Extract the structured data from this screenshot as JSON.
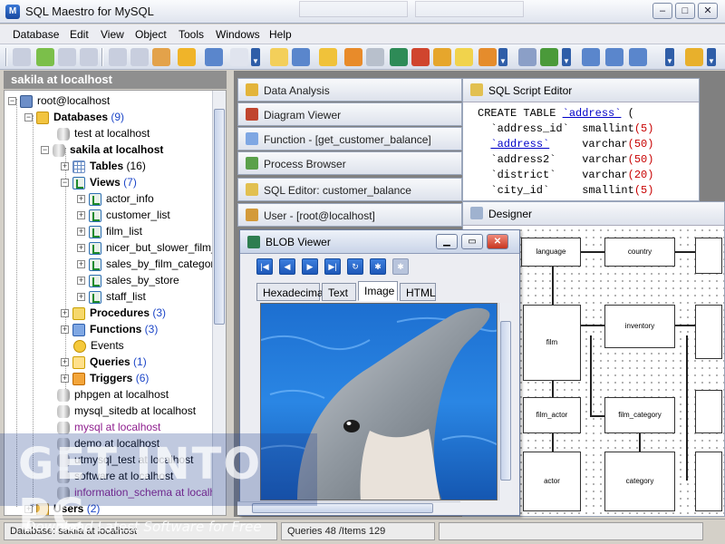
{
  "app": {
    "title": "SQL Maestro for MySQL"
  },
  "window_controls": {
    "minimize": "–",
    "maximize": "□",
    "close": "✕"
  },
  "menu": {
    "items": [
      "Database",
      "Edit",
      "View",
      "Object",
      "Tools",
      "Windows",
      "Help"
    ]
  },
  "explorer": {
    "header": "sakila at localhost",
    "tree": {
      "root": "root@localhost",
      "databases_label": "Databases",
      "databases_count": "(9)",
      "test": "test at localhost",
      "sakila": "sakila at localhost",
      "tables_label": "Tables",
      "tables_count": "(16)",
      "views_label": "Views",
      "views_count": "(7)",
      "views": [
        "actor_info",
        "customer_list",
        "film_list",
        "nicer_but_slower_film_",
        "sales_by_film_categor",
        "sales_by_store",
        "staff_list"
      ],
      "procedures_label": "Procedures",
      "procedures_count": "(3)",
      "functions_label": "Functions",
      "functions_count": "(3)",
      "events_label": "Events",
      "queries_label": "Queries",
      "queries_count": "(1)",
      "triggers_label": "Triggers",
      "triggers_count": "(6)",
      "other_dbs": [
        "phpgen at localhost",
        "mysql_sitedb at localhost",
        "mysql at localhost",
        "demo at localhost",
        "utmysql_test at localhost",
        "software at localhost",
        "information_schema at localhos"
      ],
      "users_label": "Users",
      "users_count": "(2)"
    }
  },
  "mdi_windows": [
    "Data Analysis",
    "Diagram Viewer",
    "Function - [get_customer_balance]",
    "Process Browser",
    "SQL Editor: customer_balance",
    "User - [root@localhost]"
  ],
  "sql_editor": {
    "title": "SQL Script Editor",
    "lines": [
      {
        "a": "CREATE TABLE ",
        "b": "`address`",
        "c": " ("
      },
      {
        "a": "  `address_id`  ",
        "b": "smallint",
        "c": "(5)"
      },
      {
        "a": "  ",
        "b2": "`address`",
        "c2": "     varchar",
        "d": "(50)"
      },
      {
        "a": "  `address2`    ",
        "b": "varchar",
        "c": "(50)"
      },
      {
        "a": "  `district`    ",
        "b": "varchar",
        "c": "(20)"
      },
      {
        "a": "  `city_id`     ",
        "b": "smallint",
        "c": "(5)"
      }
    ]
  },
  "designer": {
    "title": "Designer",
    "entities": [
      "language",
      "country",
      "film",
      "inventory",
      "film_actor",
      "film_category",
      "actor",
      "category"
    ]
  },
  "blob_viewer": {
    "title": "BLOB Viewer",
    "tabs": [
      "Hexadecimal",
      "Text",
      "Image",
      "HTML"
    ],
    "active_tab": "Image"
  },
  "status": {
    "database": "Database: sakila at localhost",
    "queries": "Queries 48 /Items 129"
  },
  "watermark": {
    "text": "GET INTO PC",
    "subtitle": "Download Latest Software for Free"
  }
}
